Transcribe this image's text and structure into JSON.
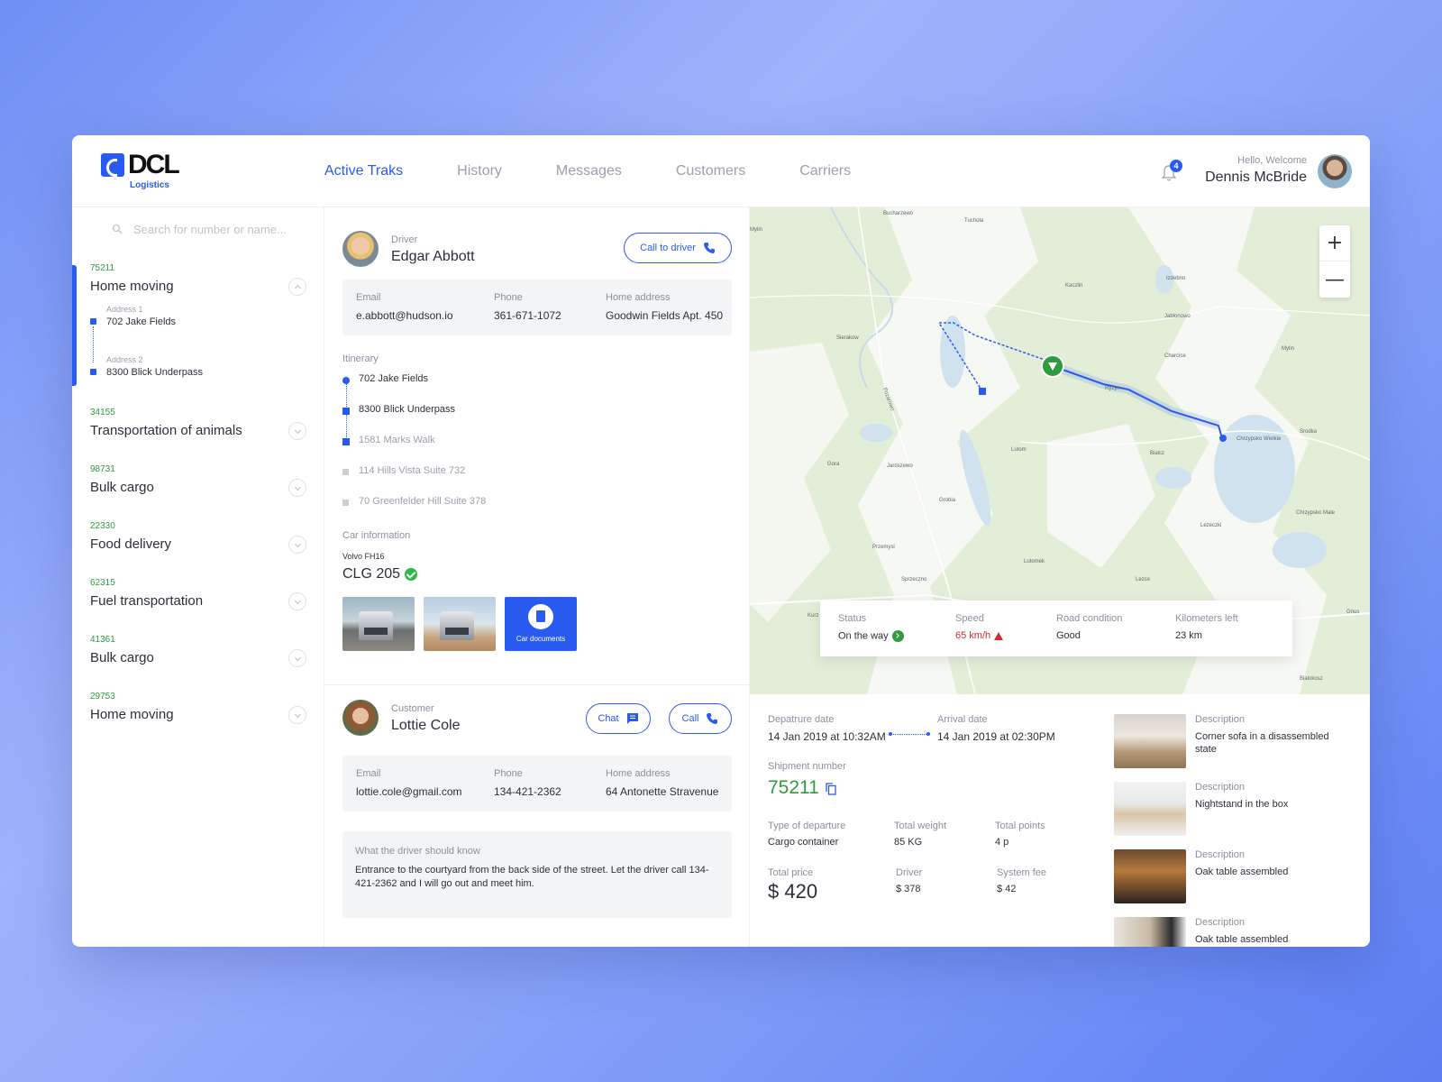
{
  "brand": {
    "name": "DCL",
    "sub": "Logistics"
  },
  "nav": [
    {
      "label": "Active Traks",
      "active": true
    },
    {
      "label": "History",
      "active": false
    },
    {
      "label": "Messages",
      "active": false
    },
    {
      "label": "Customers",
      "active": false
    },
    {
      "label": "Carriers",
      "active": false
    }
  ],
  "notifications": {
    "count": "4"
  },
  "user": {
    "greeting": "Hello, Welcome",
    "name": "Dennis McBride"
  },
  "search": {
    "placeholder": "Search for number or name..."
  },
  "orders": [
    {
      "id": "75211",
      "title": "Home moving",
      "expanded": true,
      "addresses": [
        {
          "label": "Address 1",
          "value": "702 Jake Fields"
        },
        {
          "label": "Address 2",
          "value": "8300 Blick Underpass"
        }
      ]
    },
    {
      "id": "34155",
      "title": "Transportation of animals"
    },
    {
      "id": "98731",
      "title": "Bulk cargo"
    },
    {
      "id": "22330",
      "title": "Food delivery"
    },
    {
      "id": "62315",
      "title": "Fuel transportation"
    },
    {
      "id": "41361",
      "title": "Bulk cargo"
    },
    {
      "id": "29753",
      "title": "Home moving"
    }
  ],
  "driver": {
    "role": "Driver",
    "name": "Edgar Abbott",
    "call_label": "Call to driver",
    "email_label": "Email",
    "email": "e.abbott@hudson.io",
    "phone_label": "Phone",
    "phone": "361-671-1072",
    "home_label": "Home address",
    "home": "Goodwin Fields Apt. 450"
  },
  "itinerary": {
    "label": "Itinerary",
    "stops": [
      {
        "text": "702 Jake Fields",
        "state": "done"
      },
      {
        "text": "8300 Blick Underpass",
        "state": "done"
      },
      {
        "text": "1581 Marks Walk",
        "state": "current"
      },
      {
        "text": "114 Hills Vista Suite 732",
        "state": "pending"
      },
      {
        "text": "70 Greenfelder Hill Suite 378",
        "state": "pending"
      }
    ]
  },
  "car": {
    "label": "Car information",
    "model": "Volvo FH16",
    "plate": "CLG 205",
    "documents_label": "Car documents"
  },
  "customer": {
    "role": "Customer",
    "name": "Lottie Cole",
    "chat_label": "Chat",
    "call_label": "Call",
    "email_label": "Email",
    "email": "lottie.cole@gmail.com",
    "phone_label": "Phone",
    "phone": "134-421-2362",
    "home_label": "Home address",
    "home": "64 Antonette Stravenue",
    "note_label": "What the driver should know",
    "note": "Entrance to the courtyard from the back side of the street. Let the driver call 134-421-2362 and I will go out and meet him."
  },
  "map": {
    "towns": [
      "Bucharzewo",
      "Tuchola",
      "Mylin",
      "Kaczlin",
      "Izdebno",
      "Jablonowo",
      "Sierakow",
      "Charcice",
      "Mylin",
      "Ryzyn",
      "Srodka",
      "Chrzypsko Wielkie",
      "Bialcz",
      "Lutom",
      "Gora",
      "Jaroszewo",
      "Grobia",
      "Chrzypsko Male",
      "Lezeczki",
      "Przemysl",
      "Lutomek",
      "Sprzeczno",
      "Lezce",
      "Kurz",
      "Gnus",
      "Bialokosz",
      "Pozarowo"
    ],
    "zoom_in": "+",
    "zoom_out": "—"
  },
  "status": {
    "status_label": "Status",
    "status": "On the way",
    "speed_label": "Speed",
    "speed": "65 km/h",
    "road_label": "Road condition",
    "road": "Good",
    "km_label": "Kilometers left",
    "km": "23 km"
  },
  "shipment": {
    "departure_label": "Depatrure date",
    "departure": "14 Jan 2019 at 10:32AM",
    "arrival_label": "Arrival date",
    "arrival": "14 Jan 2019 at 02:30PM",
    "number_label": "Shipment number",
    "number": "75211",
    "type_label": "Type of departure",
    "type": "Cargo container",
    "weight_label": "Total weight",
    "weight": "85 KG",
    "points_label": "Total points",
    "points": "4 p",
    "price_label": "Total price",
    "price": "$ 420",
    "driver_label": "Driver",
    "driver": "$ 378",
    "fee_label": "System fee",
    "fee": "$ 42"
  },
  "items": [
    {
      "label": "Description",
      "desc": "Corner sofa in a disassembled state"
    },
    {
      "label": "Description",
      "desc": "Nightstand in the box"
    },
    {
      "label": "Description",
      "desc": "Oak table assembled"
    },
    {
      "label": "Description",
      "desc": "Oak table assembled"
    }
  ],
  "colors": {
    "accent": "#2a5bf0",
    "success": "#2e9c3f",
    "danger": "#d12c2c"
  }
}
